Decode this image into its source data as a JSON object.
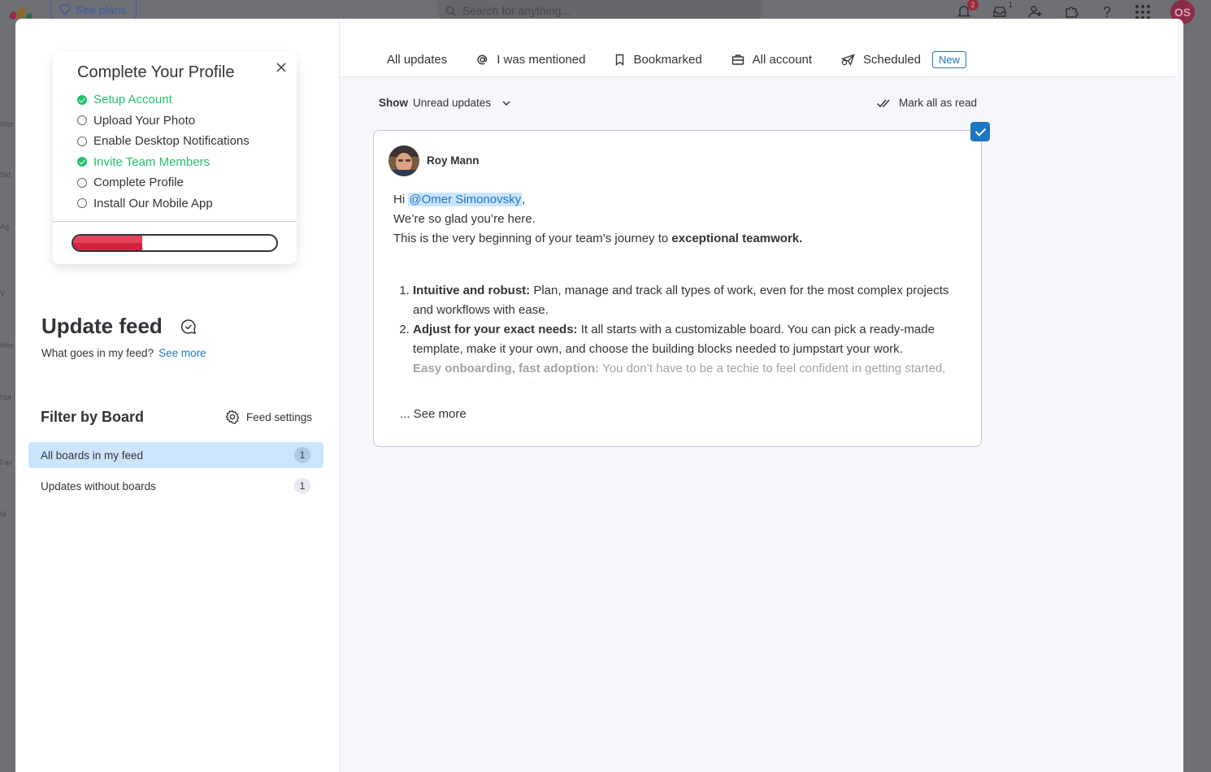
{
  "background_app": {
    "see_plans": "See plans",
    "search_placeholder": "Search for anything...",
    "notifications_count": "2",
    "inbox_count": "1",
    "avatar_initials": "OS",
    "left_strip": [
      "Wor",
      "Sid",
      "Ag",
      "V",
      "Wor",
      "Not",
      "Fav",
      "M"
    ]
  },
  "profile": {
    "title": "Complete Your Profile",
    "items": [
      {
        "label": "Setup Account",
        "done": true
      },
      {
        "label": "Upload Your Photo",
        "done": false
      },
      {
        "label": "Enable Desktop Notifications",
        "done": false
      },
      {
        "label": "Invite Team Members",
        "done": true
      },
      {
        "label": "Complete Profile",
        "done": false
      },
      {
        "label": "Install Our Mobile App",
        "done": false
      }
    ],
    "progress_percent": 34,
    "progress_color": "#e44258"
  },
  "feed": {
    "title": "Update feed",
    "subtitle": "What goes in my feed?",
    "see_more": "See more"
  },
  "filter": {
    "title": "Filter by Board",
    "settings_label": "Feed settings",
    "boards": [
      {
        "label": "All boards in my feed",
        "count": "1",
        "selected": true
      },
      {
        "label": "Updates without boards",
        "count": "1",
        "selected": false
      }
    ]
  },
  "tabs": {
    "all_updates": "All updates",
    "mentioned": "I was mentioned",
    "bookmarked": "Bookmarked",
    "all_account": "All account",
    "scheduled": "Scheduled",
    "new_badge": "New"
  },
  "toolbar": {
    "show_label": "Show",
    "show_value": "Unread updates",
    "mark_all_read": "Mark all as read"
  },
  "post": {
    "author": "Roy Mann",
    "greeting": "Hi",
    "mention": "@Omer Simonovsky",
    "line2": "We’re so glad you’re here.",
    "line3_prefix": "This is the very beginning of your team’s journey to",
    "line3_bold": "exceptional teamwork.",
    "points": [
      {
        "bold": "Intuitive and robust:",
        "text": "Plan, manage and track all types of work, even for the most complex projects and workflows with ease."
      },
      {
        "bold": "Adjust for your exact needs:",
        "text": "It all starts with a customizable board. You can pick a ready-made template, make it your own, and choose the building blocks needed to jumpstart your work."
      },
      {
        "bold": "Easy onboarding, fast adoption:",
        "text": "You don’t have to be a techie to feel confident in getting started, which makes onboarding anyone in your team as simple as using their phone."
      }
    ],
    "see_more": "... See more"
  },
  "colors": {
    "accent_blue": "#1f76c2",
    "done_green": "#22c26a",
    "selected_bg": "#cce5ff"
  }
}
